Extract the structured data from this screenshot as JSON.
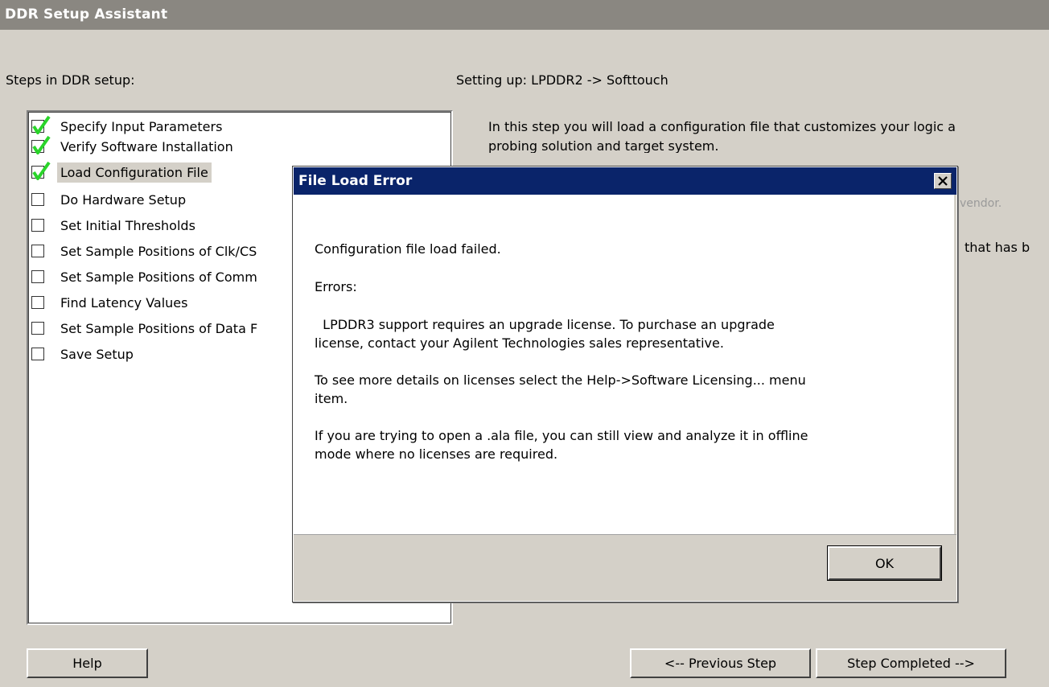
{
  "window": {
    "title": "DDR Setup Assistant"
  },
  "steps_panel": {
    "heading": "Steps in DDR setup:",
    "items": [
      {
        "label": "Specify Input Parameters",
        "checked": true
      },
      {
        "label": "Verify Software Installation",
        "checked": true
      },
      {
        "label": "Load Configuration File",
        "checked": true,
        "selected": true
      },
      {
        "label": "Do Hardware Setup",
        "checked": false
      },
      {
        "label": "Set Initial Thresholds",
        "checked": false
      },
      {
        "label": "Set Sample Positions of Clk/CS",
        "checked": false
      },
      {
        "label": "Set Sample Positions of Comm",
        "checked": false
      },
      {
        "label": "Find Latency Values",
        "checked": false
      },
      {
        "label": "Set Sample Positions of Data F",
        "checked": false
      },
      {
        "label": "Save Setup",
        "checked": false
      }
    ]
  },
  "main": {
    "setting_up": "Setting up: LPDDR2 -> Softtouch",
    "desc_line1": "In this step you will load a configuration file that customizes your logic a",
    "desc_line2": "probing solution and target system.",
    "partial_vendor": "vendor.",
    "partial_has": "that has b"
  },
  "dialog": {
    "title": "File Load Error",
    "close_glyph": "✕",
    "message": "Configuration file load failed.",
    "errors_label": "Errors:",
    "error_line1": "  LPDDR3 support requires an upgrade license. To purchase an upgrade",
    "error_line2": "license, contact your Agilent Technologies sales representative.",
    "details_line1": "To see more details on licenses select the Help->Software Licensing... menu",
    "details_line2": "item.",
    "offline_line1": "If you are trying to open a .ala file, you can still view and analyze it in offline",
    "offline_line2": "mode where no licenses are required.",
    "ok_label": "OK"
  },
  "buttons": {
    "help": "Help",
    "previous": "<-- Previous Step",
    "completed": "Step Completed -->"
  },
  "colors": {
    "window_bg": "#d4d0c8",
    "titlebar_bg": "#8a8781",
    "dialog_titlebar_bg": "#0a246a",
    "check_green": "#2ad42a"
  },
  "icons": {
    "check": "check-icon",
    "close": "close-icon"
  }
}
